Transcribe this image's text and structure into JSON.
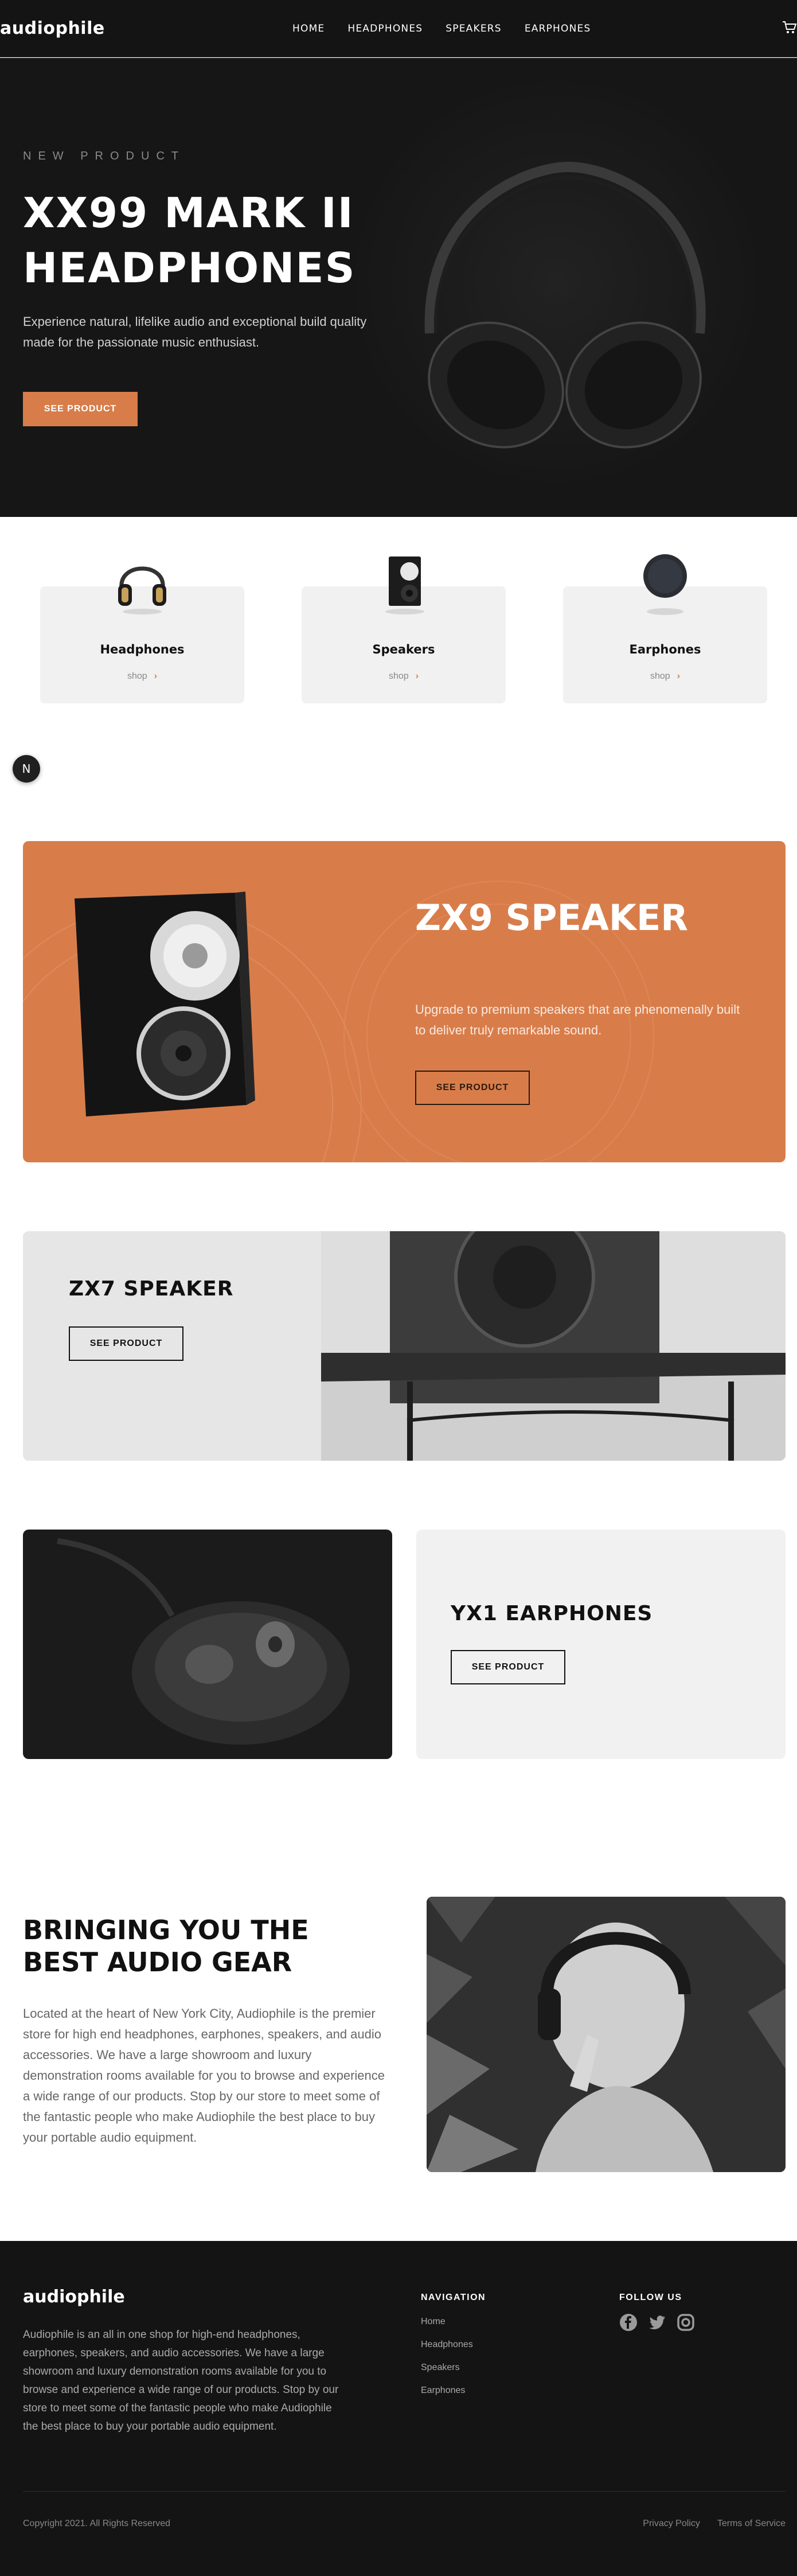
{
  "header": {
    "logo": "audiophile",
    "nav": [
      "HOME",
      "HEADPHONES",
      "SPEAKERS",
      "EARPHONES"
    ],
    "cart_icon": "cart-icon"
  },
  "hero": {
    "overline": "NEW PRODUCT",
    "title": "XX99 MARK II HEADPHONES",
    "description": "Experience natural, lifelike audio and exceptional build quality made for the passionate music enthusiast.",
    "cta": "SEE PRODUCT"
  },
  "categories": [
    {
      "title": "Headphones",
      "shop": "shop"
    },
    {
      "title": "Speakers",
      "shop": "shop"
    },
    {
      "title": "Earphones",
      "shop": "shop"
    }
  ],
  "floating_badge": "N",
  "zx9": {
    "title": "ZX9 SPEAKER",
    "description": "Upgrade to premium speakers that are phenomenally built to deliver truly remarkable sound.",
    "cta": "SEE PRODUCT"
  },
  "zx7": {
    "title": "ZX7 SPEAKER",
    "cta": "SEE PRODUCT"
  },
  "yx1": {
    "title": "YX1 EARPHONES",
    "cta": "SEE PRODUCT"
  },
  "about": {
    "title": "BRINGING YOU THE BEST AUDIO GEAR",
    "description": "Located at the heart of New York City, Audiophile is the premier store for high end headphones, earphones, speakers, and audio accessories. We have a large showroom and luxury demonstration rooms available for you to browse and experience a wide range of our products. Stop by our store to meet some of the fantastic people who make Audiophile the best place to buy your portable audio equipment."
  },
  "footer": {
    "logo": "audiophile",
    "description": "Audiophile is an all in one shop for high-end headphones, earphones, speakers, and audio accessories. We have a large showroom and luxury demonstration rooms available for you to browse and experience a wide range of our products. Stop by our store to meet some of the fantastic people who make Audiophile the best place to buy your portable audio equipment.",
    "nav_heading": "NAVIGATION",
    "nav_links": [
      "Home",
      "Headphones",
      "Speakers",
      "Earphones"
    ],
    "follow_heading": "FOLLOW US",
    "social_icons": [
      "facebook-icon",
      "twitter-icon",
      "instagram-icon"
    ],
    "copyright": "Copyright 2021. All Rights Reserved",
    "legal": [
      "Privacy Policy",
      "Terms of Service"
    ]
  },
  "colors": {
    "accent": "#d87d4a",
    "dark": "#141414",
    "light_card": "#f1f1f1"
  }
}
